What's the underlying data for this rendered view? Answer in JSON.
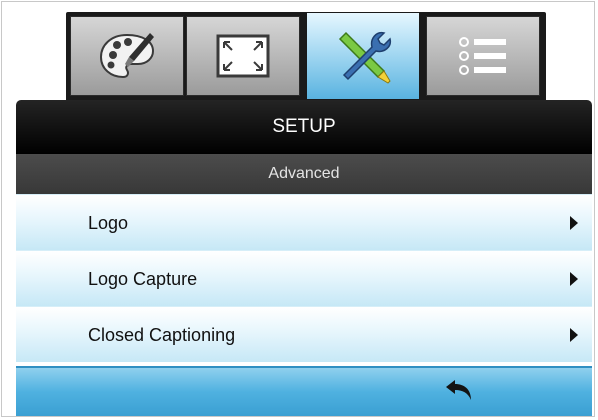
{
  "tabs": [
    {
      "icon": "palette-icon",
      "active": false
    },
    {
      "icon": "aspect-expand-icon",
      "active": false
    },
    {
      "icon": "tools-icon",
      "active": true
    },
    {
      "icon": "list-options-icon",
      "active": false
    }
  ],
  "header": {
    "title": "SETUP",
    "subtitle": "Advanced"
  },
  "menu": {
    "items": [
      {
        "label": "Logo"
      },
      {
        "label": "Logo Capture"
      },
      {
        "label": "Closed Captioning"
      }
    ]
  },
  "footer": {
    "back_icon": "return-arrow-icon"
  },
  "colors": {
    "accent": "#59b3e0",
    "header_bg": "#000000",
    "subheader_bg": "#404040"
  }
}
